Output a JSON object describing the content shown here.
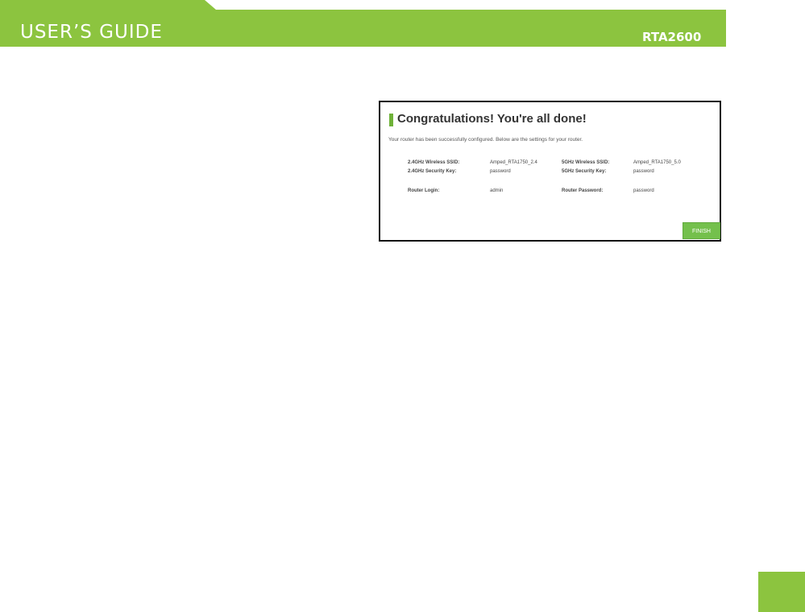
{
  "header": {
    "title": "USER’S GUIDE",
    "model": "RTA2600"
  },
  "screenshot": {
    "heading": "Congratulations! You're all done!",
    "intro": "Your router has been successfully configured. Below are the settings for your router.",
    "rows": [
      {
        "left_label": "2.4GHz Wireless SSID:",
        "left_value": "Amped_RTA1750_2.4",
        "right_label": "5GHz Wireless SSID:",
        "right_value": "Amped_RTA1750_5.0"
      },
      {
        "left_label": "2.4GHz Security Key:",
        "left_value": "password",
        "right_label": "5GHz Security Key:",
        "right_value": "password"
      },
      {
        "left_label": "Router Login:",
        "left_value": "admin",
        "right_label": "Router Password:",
        "right_value": "password"
      }
    ],
    "finish_label": "FINISH"
  },
  "colors": {
    "brand_green": "#8cc43f",
    "button_green": "#74c04c"
  }
}
